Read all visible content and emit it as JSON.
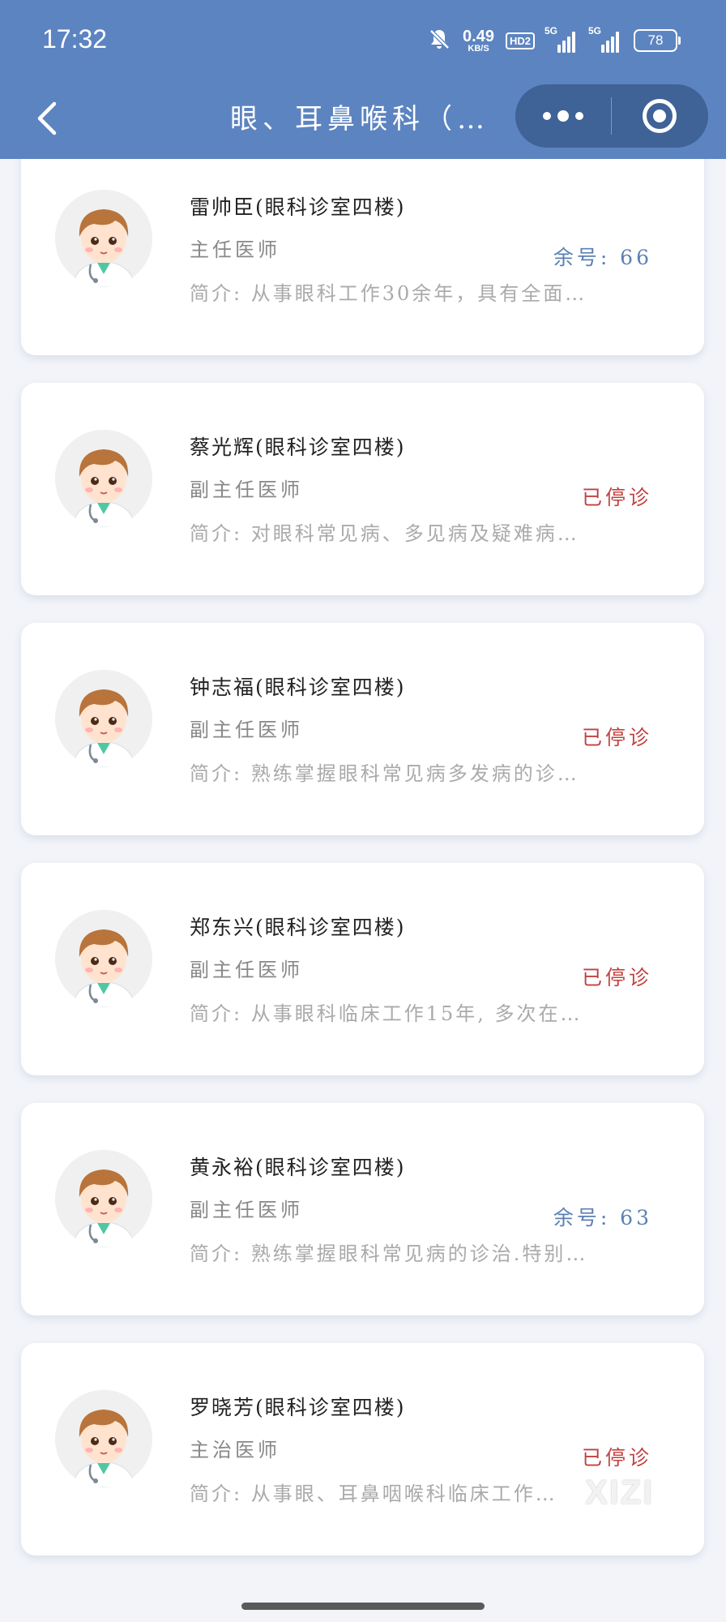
{
  "status_bar": {
    "time": "17:32",
    "net_speed_value": "0.49",
    "net_speed_unit": "KB/S",
    "hd_label": "HD2",
    "signal1_label": "5G",
    "signal2_label": "5G",
    "battery": "78"
  },
  "navbar": {
    "title": "眼、耳鼻喉科（…"
  },
  "doctors": [
    {
      "name": "雷帅臣(眼科诊室四楼)",
      "title": "主任医师",
      "status": "余号: 66",
      "status_type": "available",
      "intro": "简介: 从事眼科工作30余年，具有全面…"
    },
    {
      "name": "蔡光辉(眼科诊室四楼)",
      "title": "副主任医师",
      "status": "已停诊",
      "status_type": "stopped",
      "intro": "简介: 对眼科常见病、多见病及疑难病…"
    },
    {
      "name": "钟志福(眼科诊室四楼)",
      "title": "副主任医师",
      "status": "已停诊",
      "status_type": "stopped",
      "intro": "简介: 熟练掌握眼科常见病多发病的诊…"
    },
    {
      "name": "郑东兴(眼科诊室四楼)",
      "title": "副主任医师",
      "status": "已停诊",
      "status_type": "stopped",
      "intro": "简介: 从事眼科临床工作15年, 多次在…"
    },
    {
      "name": "黄永裕(眼科诊室四楼)",
      "title": "副主任医师",
      "status": "余号: 63",
      "status_type": "available",
      "intro": "简介: 熟练掌握眼科常见病的诊治.特别…"
    },
    {
      "name": "罗晓芳(眼科诊室四楼)",
      "title": "主治医师",
      "status": "已停诊",
      "status_type": "stopped",
      "intro": "简介: 从事眼、耳鼻咽喉科临床工作…"
    }
  ],
  "watermark": "XIZI",
  "colors": {
    "header_bg": "#5c84c0",
    "capsule_bg": "#3f6297",
    "available": "#5b80b3",
    "stopped": "#c04242"
  },
  "icons": {
    "back": "chevron-left-icon",
    "more": "more-dots-icon",
    "close": "target-close-icon",
    "avatar": "doctor-avatar-icon"
  }
}
